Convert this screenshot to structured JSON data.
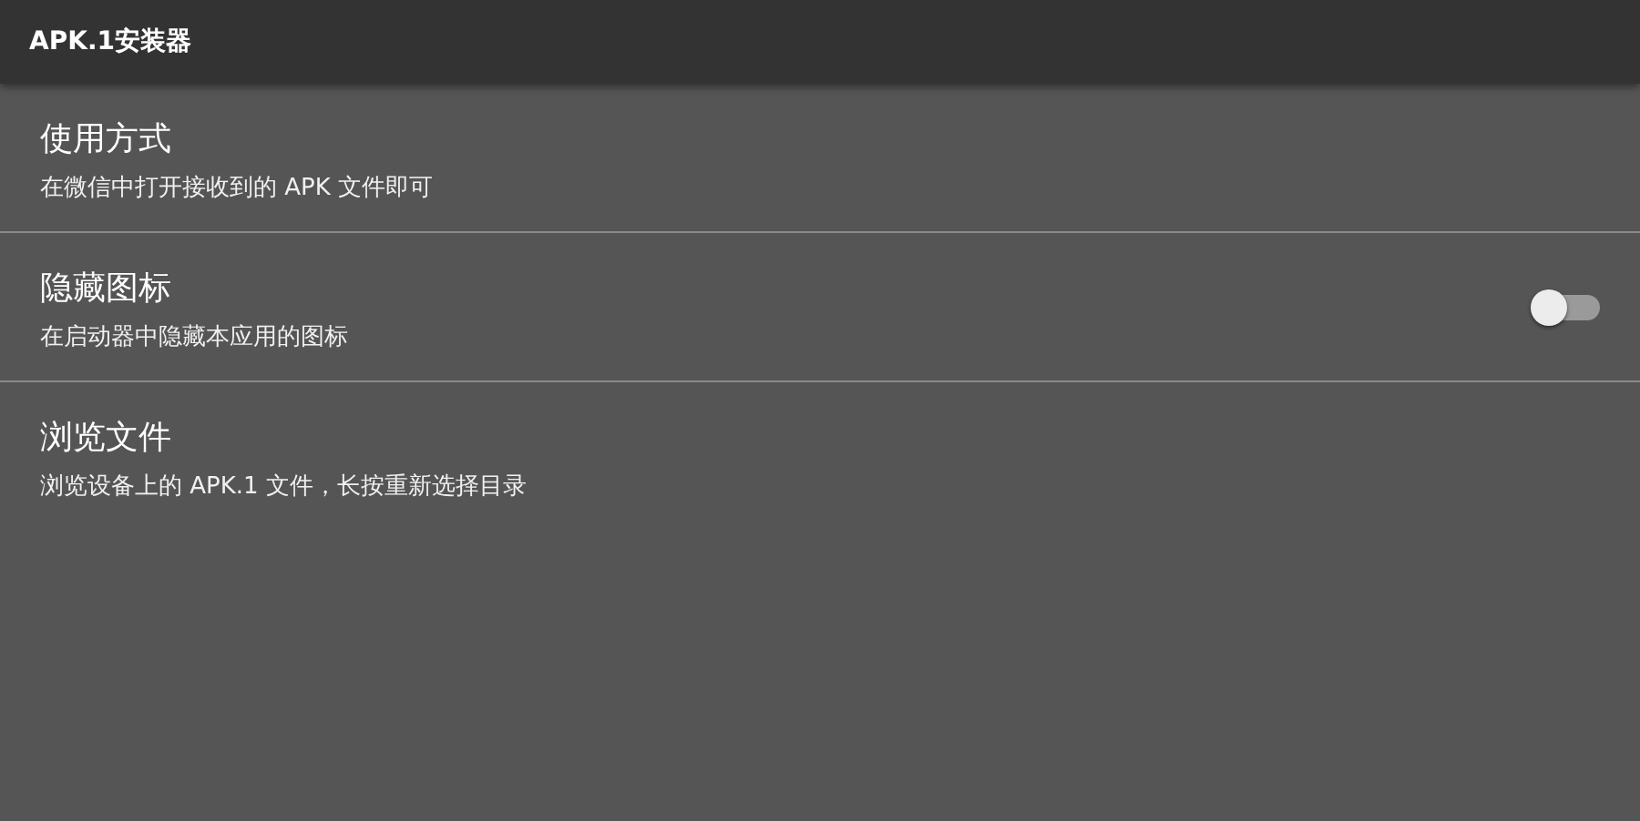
{
  "app_bar": {
    "title": "APK.1安装器"
  },
  "settings": [
    {
      "kind": "plain",
      "title": "使用方式",
      "summary": "在微信中打开接收到的 APK 文件即可"
    },
    {
      "kind": "switch",
      "title": "隐藏图标",
      "summary": "在启动器中隐藏本应用的图标",
      "on": false
    },
    {
      "kind": "plain",
      "title": "浏览文件",
      "summary": "浏览设备上的 APK.1 文件，长按重新选择目录"
    }
  ]
}
